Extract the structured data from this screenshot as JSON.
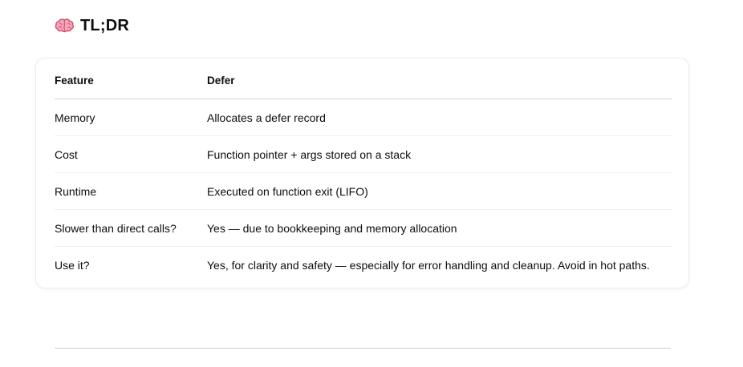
{
  "heading": {
    "icon": "brain-icon",
    "title": "TL;DR"
  },
  "table": {
    "headers": [
      "Feature",
      "Defer"
    ],
    "rows": [
      [
        "Memory",
        "Allocates a defer record"
      ],
      [
        "Cost",
        "Function pointer + args stored on a stack"
      ],
      [
        "Runtime",
        "Executed on function exit (LIFO)"
      ],
      [
        "Slower than direct calls?",
        "Yes — due to bookkeeping and memory allocation"
      ],
      [
        "Use it?",
        "Yes, for clarity and safety — especially for error handling and cleanup. Avoid in hot paths."
      ]
    ]
  },
  "colors": {
    "brain": "#f4a3b8",
    "brain_outline": "#c9566f",
    "text": "#0d0d0d"
  }
}
